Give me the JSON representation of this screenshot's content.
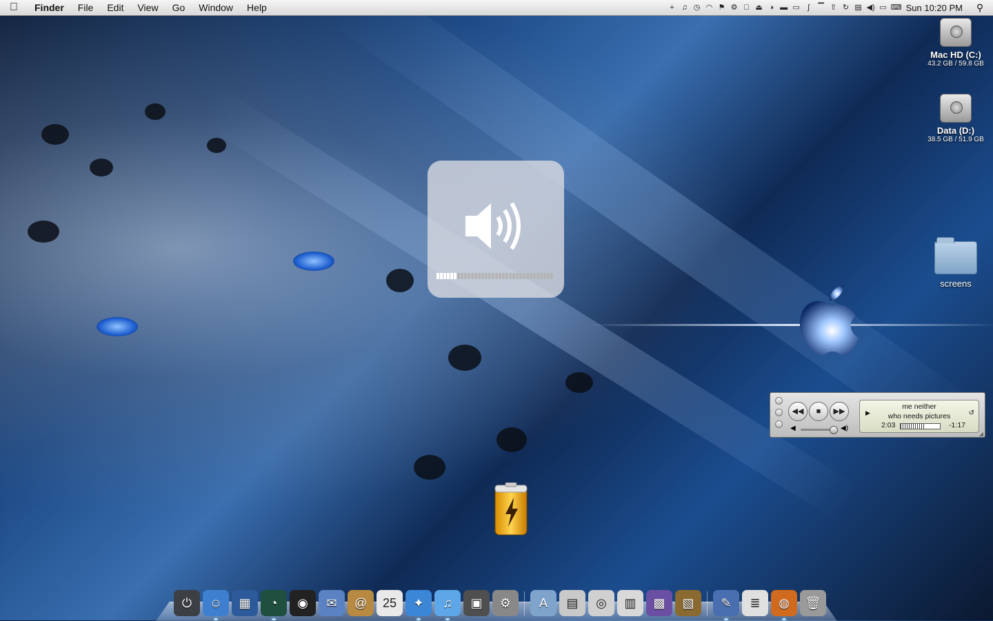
{
  "menubar": {
    "app_name": "Finder",
    "menus": [
      "File",
      "Edit",
      "View",
      "Go",
      "Window",
      "Help"
    ],
    "clock": "Sun 10:20 PM",
    "status_icons": [
      "plus-icon",
      "music-note-icon",
      "clock-icon",
      "flag-icon",
      "gears-icon",
      "apple-icon",
      "eject-icon",
      "timemachine-icon",
      "keyboard-icon",
      "monitor-icon",
      "script-icon",
      "display-icon",
      "up-arrow-icon",
      "sync-icon",
      "network-icon",
      "volume-icon",
      "battery-icon",
      "language-icon"
    ]
  },
  "desktop": {
    "drives": [
      {
        "name": "Mac HD (C:)",
        "capacity": "43.2 GB / 59.8 GB"
      },
      {
        "name": "Data (D:)",
        "capacity": "38.5 GB / 51.9 GB"
      }
    ],
    "folder": {
      "name": "screens"
    }
  },
  "volume_hud": {
    "level": 0.19,
    "segments": 16
  },
  "mini_player": {
    "track": "me neither",
    "artist": "who needs pictures",
    "elapsed": "2:03",
    "remaining": "-1:17",
    "progress": 0.62,
    "volume": 0.9
  },
  "dock": {
    "items": [
      {
        "name": "shutdown",
        "glyph": "⏻",
        "color": "#3c3f44"
      },
      {
        "name": "finder",
        "glyph": "☺",
        "color": "#3f7fd0"
      },
      {
        "name": "dashboard",
        "glyph": "▦",
        "color": "#2c5a9a"
      },
      {
        "name": "timemachine",
        "glyph": "◔",
        "color": "#1f4f3f"
      },
      {
        "name": "spaces",
        "glyph": "◉",
        "color": "#222"
      },
      {
        "name": "mail",
        "glyph": "✉",
        "color": "#5b82c2"
      },
      {
        "name": "addressbook",
        "glyph": "@",
        "color": "#b88940"
      },
      {
        "name": "calendar",
        "glyph": "25",
        "color": "#e9e9e9"
      },
      {
        "name": "safari",
        "glyph": "✦",
        "color": "#3b86d6"
      },
      {
        "name": "itunes",
        "glyph": "♫",
        "color": "#5da7e8"
      },
      {
        "name": "iphoto",
        "glyph": "▣",
        "color": "#4f4f4f"
      },
      {
        "name": "systempreferences",
        "glyph": "⚙",
        "color": "#888"
      },
      {
        "separator": true
      },
      {
        "name": "applications-folder",
        "glyph": "A",
        "color": "#7fa4cc"
      },
      {
        "name": "documents",
        "glyph": "▤",
        "color": "#c9c9c9"
      },
      {
        "name": "camera",
        "glyph": "◎",
        "color": "#d0d0d0"
      },
      {
        "name": "doc-file",
        "glyph": "▥",
        "color": "#d9d9d9"
      },
      {
        "name": "photo-viewer",
        "glyph": "▩",
        "color": "#6b4fa3"
      },
      {
        "name": "photo-booth",
        "glyph": "▧",
        "color": "#8a6a30"
      },
      {
        "separator": true
      },
      {
        "name": "xcode",
        "glyph": "✎",
        "color": "#4a6fb0"
      },
      {
        "name": "textedit",
        "glyph": "≣",
        "color": "#e0e0e0"
      },
      {
        "name": "firefox",
        "glyph": "◍",
        "color": "#d06a1f"
      },
      {
        "name": "trash",
        "glyph": "🗑",
        "color": "#9a9a9a"
      }
    ]
  }
}
